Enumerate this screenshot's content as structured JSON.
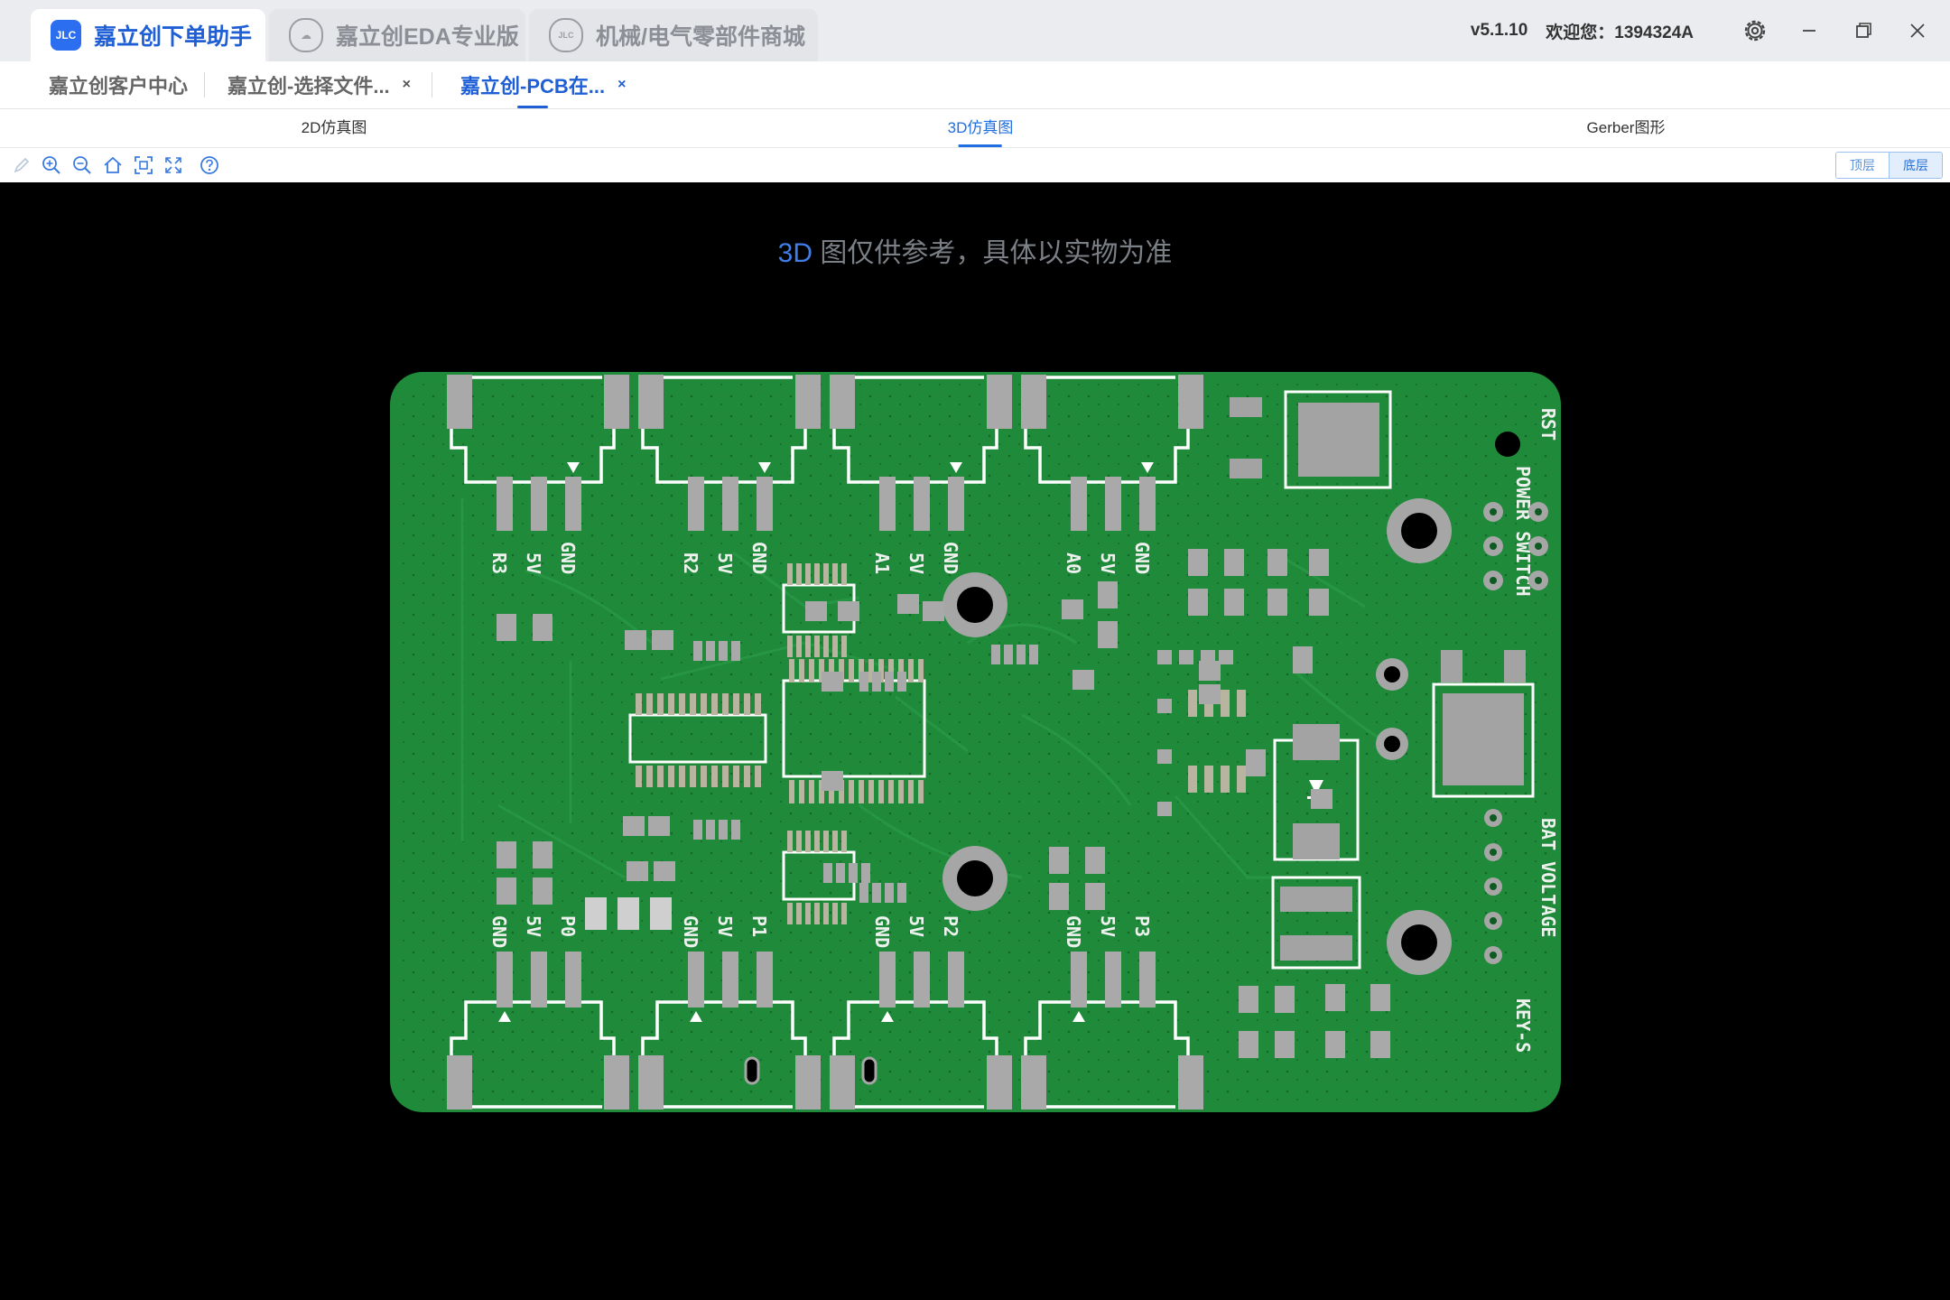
{
  "titlebar": {
    "tabs": [
      {
        "label": "嘉立创下单助手",
        "icon": "jlc-logo-icon"
      },
      {
        "label": "嘉立创EDA专业版",
        "icon": "cloud-icon"
      },
      {
        "label": "机械/电气零部件商城",
        "icon": "jlc-mall-icon"
      }
    ],
    "version": "v5.1.10",
    "welcome": "欢迎您：1394324A"
  },
  "doc_tabs": [
    {
      "label": "嘉立创客户中心",
      "closable": false
    },
    {
      "label": "嘉立创-选择文件...",
      "closable": true
    },
    {
      "label": "嘉立创-PCB在...",
      "closable": true,
      "active": true
    }
  ],
  "close_glyph": "×",
  "view_tabs": [
    {
      "label": "2D仿真图"
    },
    {
      "label": "3D仿真图",
      "active": true
    },
    {
      "label": "Gerber图形"
    }
  ],
  "toolbar": {
    "icons": [
      "pencil-icon",
      "zoom-in-icon",
      "zoom-out-icon",
      "home-icon",
      "fit-icon",
      "fullscreen-icon",
      "help-icon"
    ],
    "layer_top": "顶层",
    "layer_bottom": "底层"
  },
  "viewer": {
    "notice_prefix": "3D",
    "notice_text": " 图仅供参考，具体以实物为准"
  },
  "pcb": {
    "board_color": "#1e8a3a",
    "silk_top": [
      "R3",
      "5V",
      "GND",
      "R2",
      "5V",
      "GND",
      "A1",
      "5V",
      "GND",
      "A0",
      "5V",
      "GND"
    ],
    "silk_bottom": [
      "GND",
      "5V",
      "P0",
      "GND",
      "5V",
      "P1",
      "GND",
      "5V",
      "P2",
      "GND",
      "5V",
      "P3"
    ],
    "silk_right": [
      "RST",
      "POWER SWITCH",
      "BAT VOLTAGE",
      "KEY-S"
    ]
  },
  "colors": {
    "accent": "#1f5fd6",
    "pcb_green": "#1e8a3a",
    "pad_gray": "#a9a9a9"
  }
}
